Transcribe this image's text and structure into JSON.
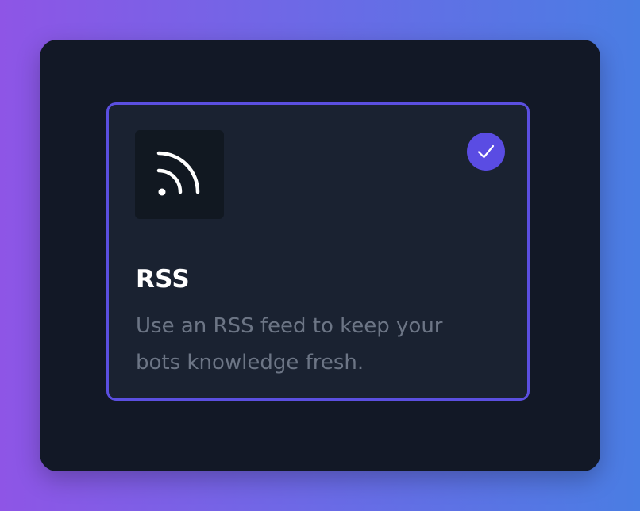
{
  "card": {
    "icon": "rss-icon",
    "selected_icon": "check-icon",
    "selected": true,
    "title": "RSS",
    "description": "Use an RSS feed to keep your bots knowledge fresh."
  },
  "colors": {
    "panel_background": "#121826",
    "card_background": "#1a2231",
    "accent": "#5b4fe0",
    "title_text": "#ffffff",
    "description_text": "#6c7585"
  }
}
